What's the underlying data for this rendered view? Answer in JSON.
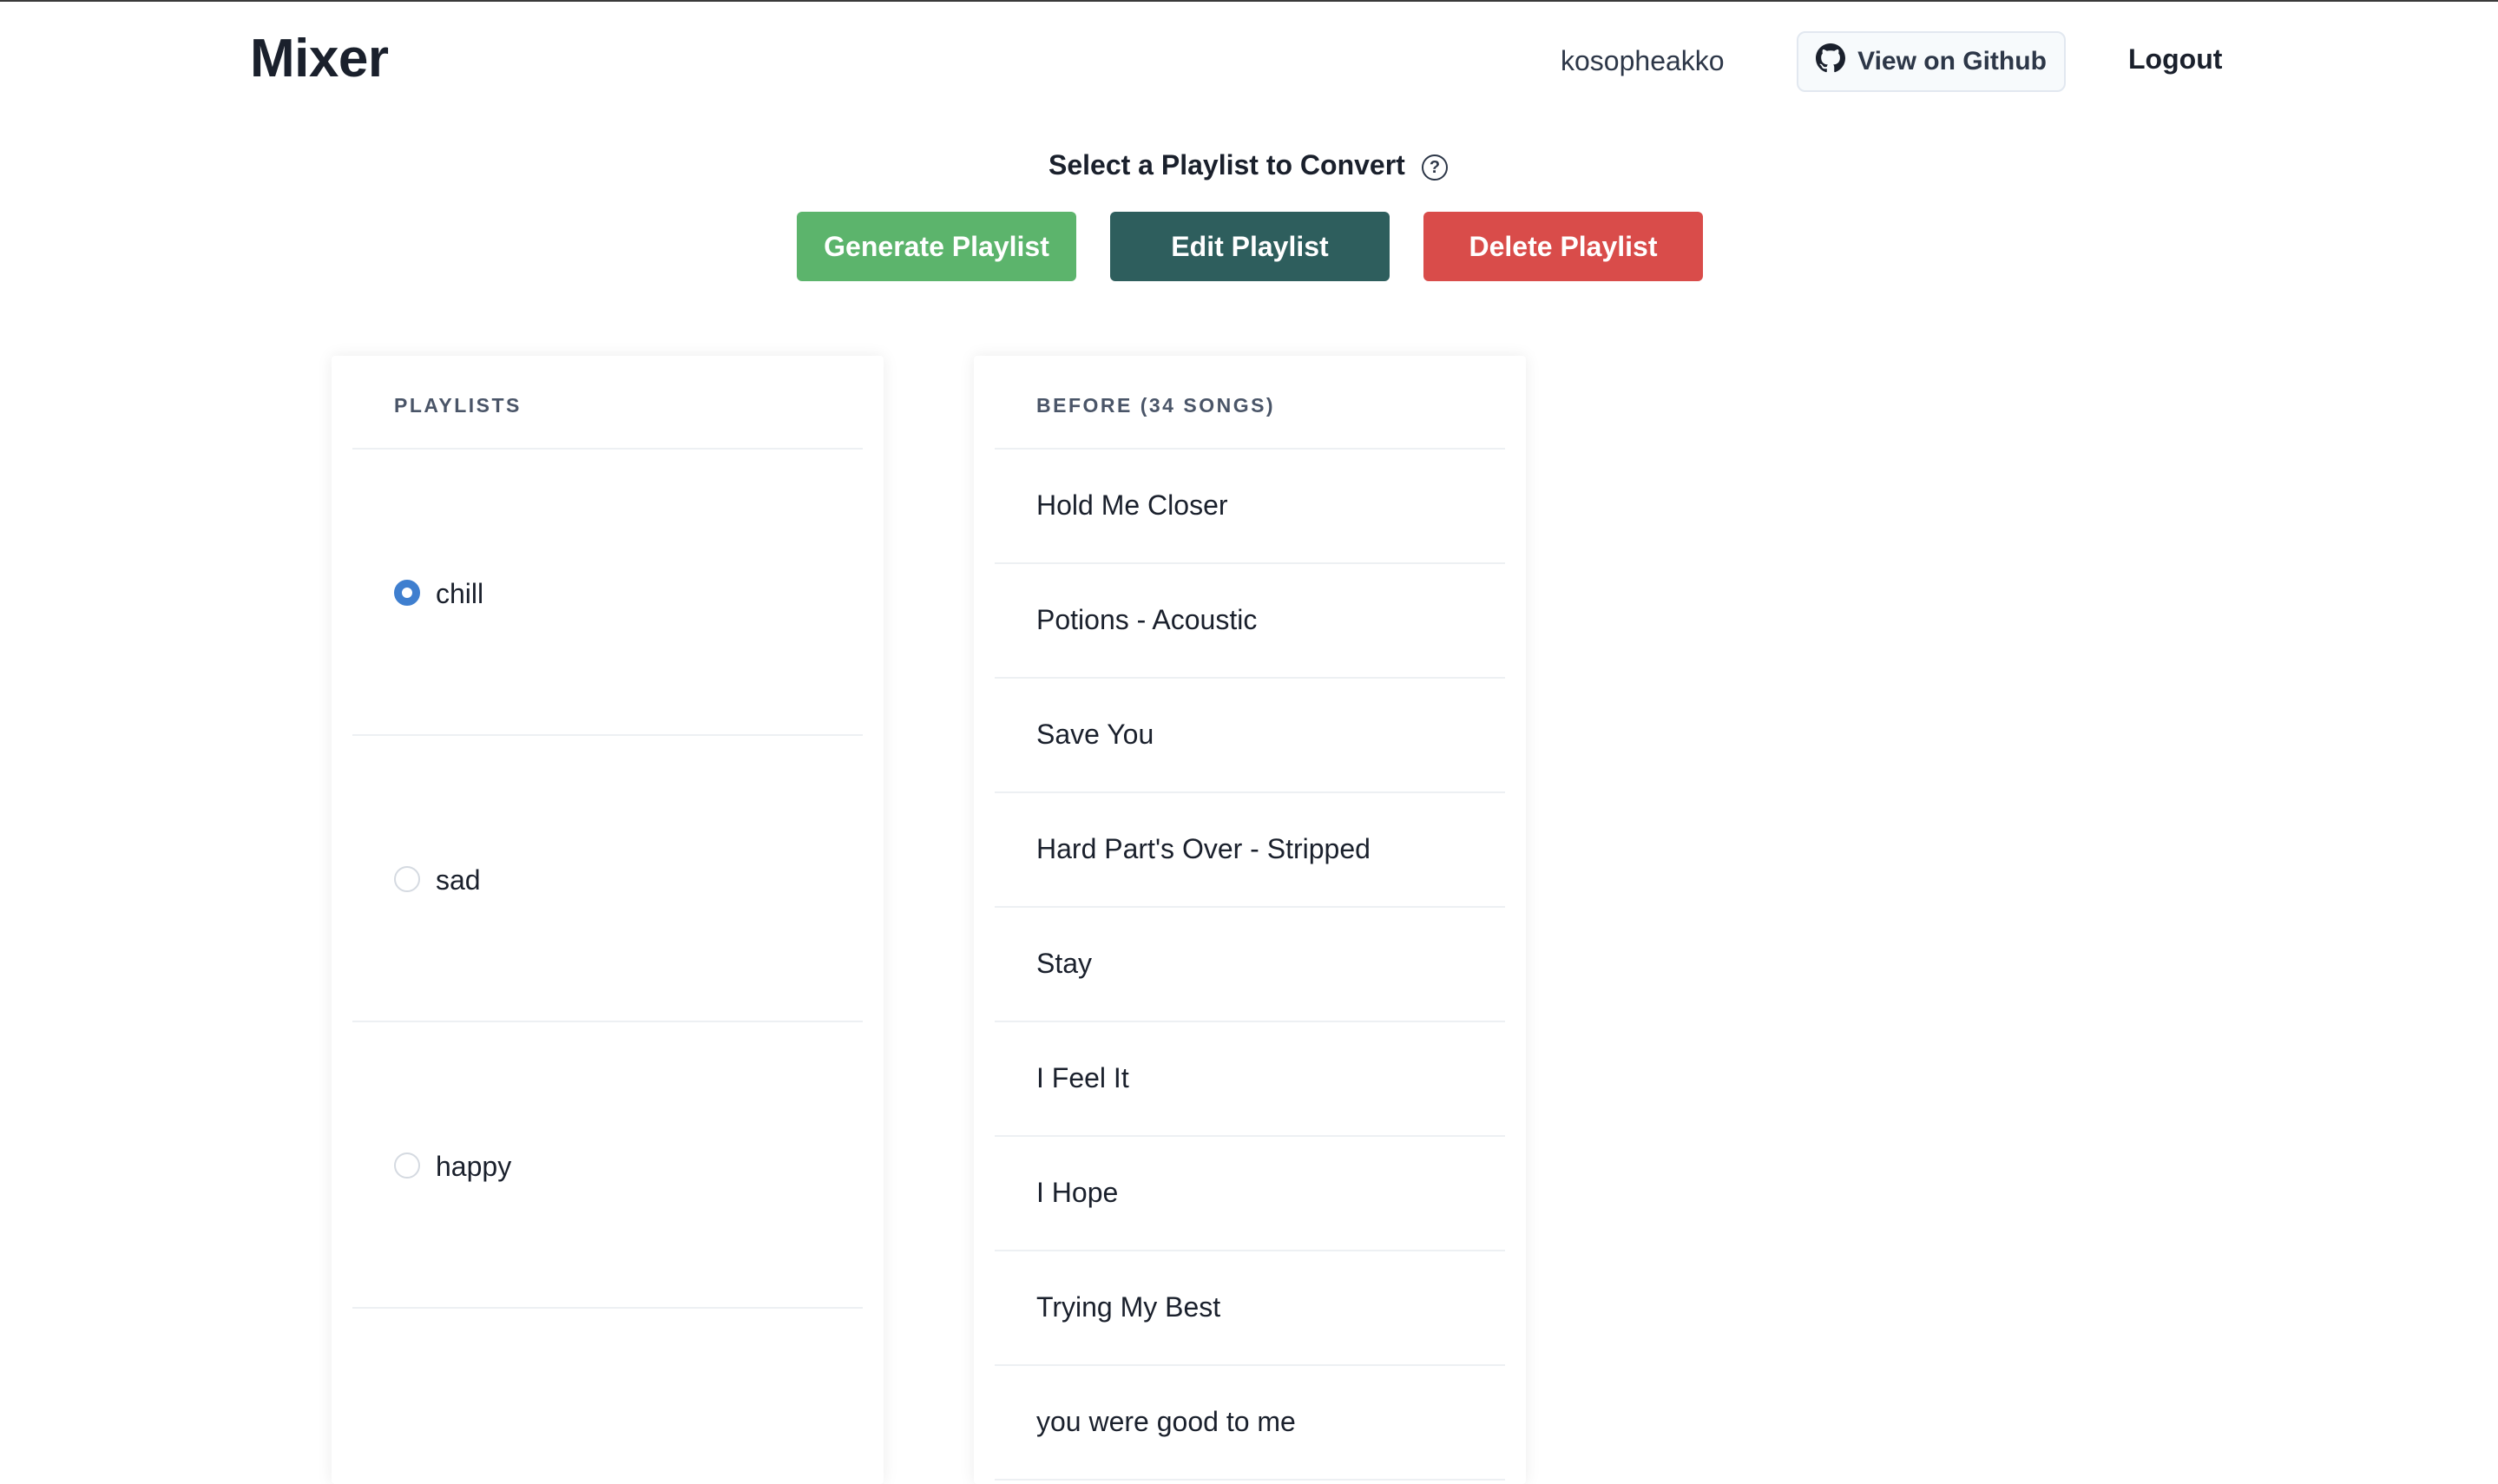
{
  "header": {
    "brand": "Mixer",
    "username": "kosopheakko",
    "github_label": "View on Github",
    "logout_label": "Logout"
  },
  "select": {
    "title": "Select a Playlist to Convert",
    "help_icon": "question-circle-icon"
  },
  "actions": {
    "generate_label": "Generate Playlist",
    "edit_label": "Edit Playlist",
    "delete_label": "Delete Playlist",
    "colors": {
      "generate": "#5cb46c",
      "edit": "#2e5e5d",
      "delete": "#d94c4a"
    }
  },
  "playlists": {
    "header": "PLAYLISTS",
    "items": [
      {
        "label": "chill",
        "selected": true
      },
      {
        "label": "sad",
        "selected": false
      },
      {
        "label": "happy",
        "selected": false
      }
    ]
  },
  "songs": {
    "header": "BEFORE (34 SONGS)",
    "items": [
      "Hold Me Closer",
      "Potions - Acoustic",
      "Save You",
      "Hard Part's Over - Stripped",
      "Stay",
      "I Feel It",
      "I Hope",
      "Trying My Best",
      "you were good to me"
    ]
  }
}
